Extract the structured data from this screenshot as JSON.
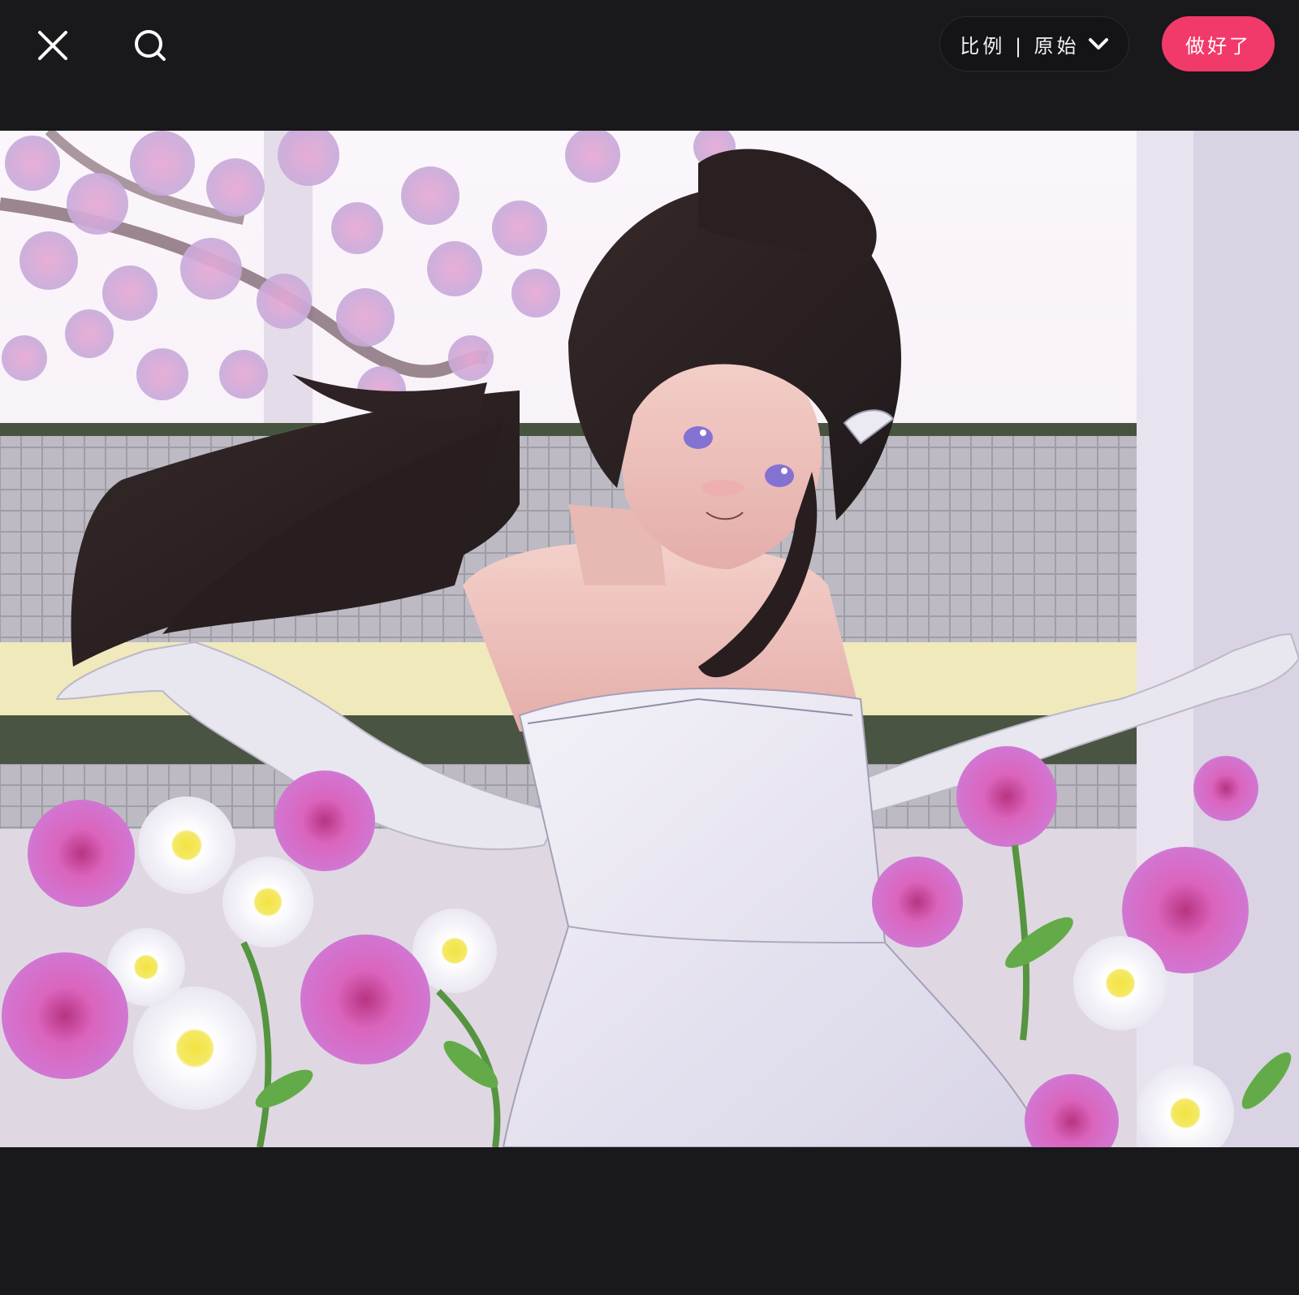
{
  "toolbar": {
    "close_icon": "close-icon",
    "search_icon": "search-icon",
    "ratio_label": "比例 | 原始",
    "ratio_chevron_icon": "chevron-down-icon",
    "done_label": "做好了"
  },
  "colors": {
    "background": "#19181b",
    "accent": "#f23a6a",
    "ratio_pill": "#141316"
  },
  "canvas": {
    "content": "photo-canvas"
  }
}
